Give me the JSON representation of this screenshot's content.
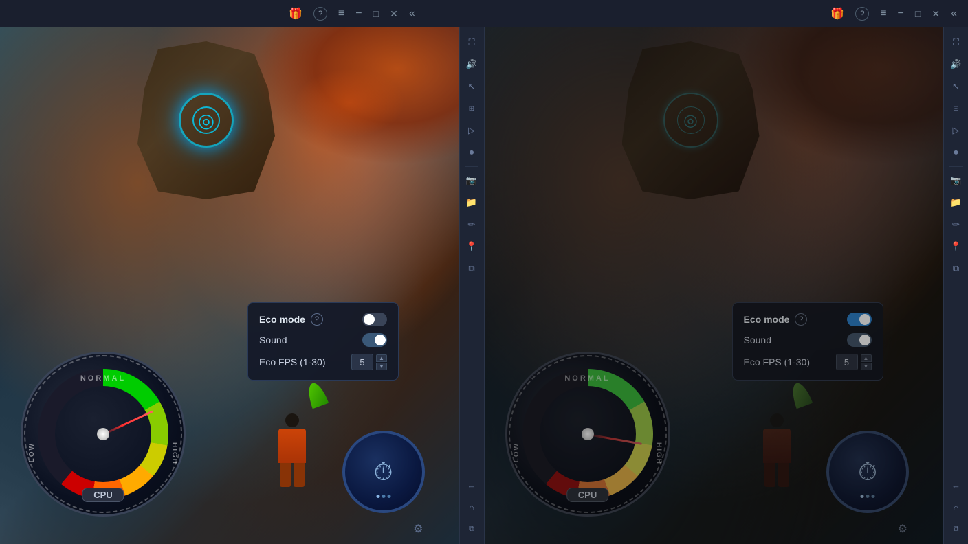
{
  "titlebar": {
    "left": {
      "gift_icon": "🎁",
      "help_icon": "?",
      "menu_icon": "≡",
      "minimize_icon": "−",
      "maximize_icon": "□",
      "close_icon": "✕",
      "back_icon": "«"
    },
    "right": {
      "gift_icon": "🎁",
      "help_icon": "?",
      "menu_icon": "≡",
      "minimize_icon": "−",
      "maximize_icon": "□",
      "close_icon": "✕",
      "back_icon": "«"
    }
  },
  "panel_left": {
    "popup": {
      "eco_mode_label": "Eco mode",
      "sound_label": "Sound",
      "fps_label": "Eco FPS (1-30)",
      "fps_value": "5",
      "eco_mode_state": "off",
      "sound_state": "indeterminate"
    },
    "gauge": {
      "normal_label": "NORMAL",
      "low_label": "LOW",
      "high_label": "HIGH",
      "cpu_label": "CPU"
    }
  },
  "panel_right": {
    "popup": {
      "eco_mode_label": "Eco mode",
      "sound_label": "Sound",
      "fps_label": "Eco FPS (1-30)",
      "fps_value": "5",
      "eco_mode_state": "on",
      "sound_state": "indeterminate"
    },
    "gauge": {
      "normal_label": "NORMAL",
      "low_label": "LOW",
      "high_label": "HIGH",
      "cpu_label": "CPU"
    }
  },
  "sidebar": {
    "icons": [
      {
        "name": "fullscreen-icon",
        "symbol": "⛶"
      },
      {
        "name": "volume-icon",
        "symbol": "🔊"
      },
      {
        "name": "cursor-icon",
        "symbol": "↖"
      },
      {
        "name": "toolbar-icon",
        "symbol": "⊞"
      },
      {
        "name": "play-icon",
        "symbol": "▷"
      },
      {
        "name": "record-icon",
        "symbol": "⏺"
      },
      {
        "name": "screenshot-icon",
        "symbol": "📷"
      },
      {
        "name": "folder-icon",
        "symbol": "📁"
      },
      {
        "name": "edit-icon",
        "symbol": "✏"
      },
      {
        "name": "location-icon",
        "symbol": "📍"
      },
      {
        "name": "layers-icon",
        "symbol": "⧉"
      },
      {
        "name": "back-nav-icon",
        "symbol": "←"
      },
      {
        "name": "home-icon",
        "symbol": "⌂"
      },
      {
        "name": "copy-icon",
        "symbol": "⧉"
      }
    ]
  }
}
